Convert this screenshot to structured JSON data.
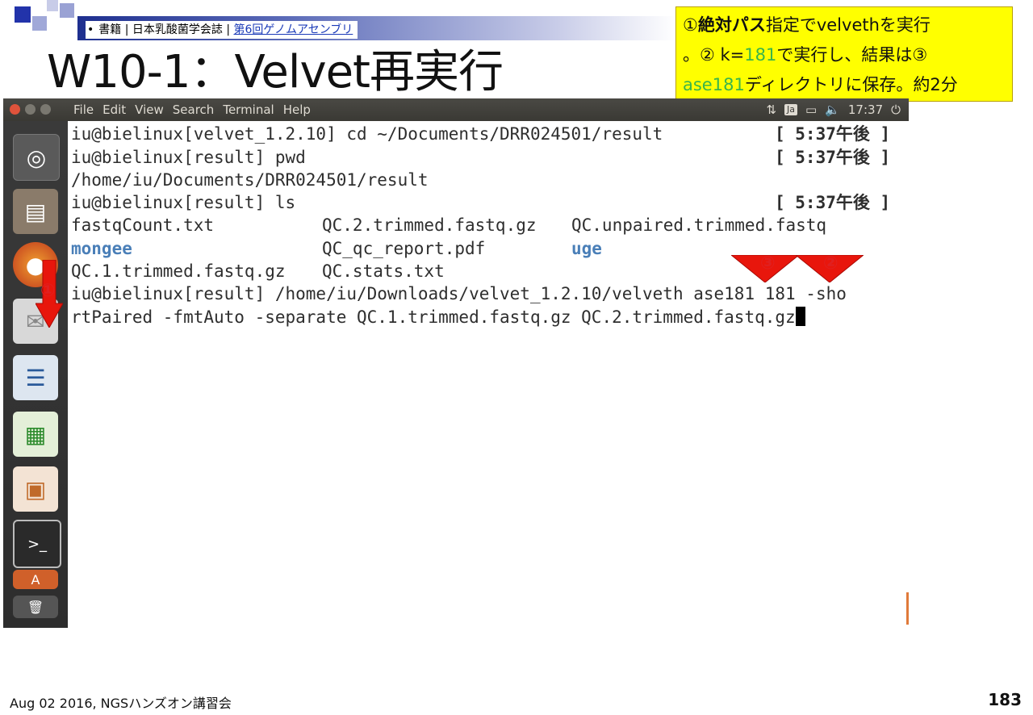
{
  "header": {
    "refs_bullet": "•",
    "refs_text": "書籍 | 日本乳酸菌学会誌 | ",
    "refs_link": "第6回ゲノムアセンブリ",
    "slide_title": "W10-1：Velvet再実行"
  },
  "callout": {
    "part1_num": "①",
    "part1_bold": "絶対パス",
    "part1_rest": "指定でvelvethを実行",
    "part2_start": "。② k=",
    "part2_green": "181",
    "part2_rest": "で実行し、結果は③",
    "part3_green": "ase181",
    "part3_rest": "ディレクトリに保存。約2分"
  },
  "window": {
    "menu": [
      "File",
      "Edit",
      "View",
      "Search",
      "Terminal",
      "Help"
    ],
    "tray": {
      "ime": "Ja",
      "time": "17:37"
    }
  },
  "launcher": {
    "items": [
      "ubuntu-dash",
      "files",
      "firefox",
      "mail",
      "writer",
      "calc",
      "impress",
      "terminal",
      "software",
      "trash"
    ]
  },
  "terminal": {
    "lines": [
      {
        "text": "iu@bielinux[velvet_1.2.10] cd ~/Documents/DRR024501/result",
        "time": "[ 5:37午後 ]"
      },
      {
        "text": "iu@bielinux[result] pwd",
        "time": "[ 5:37午後 ]"
      },
      {
        "text": "/home/iu/Documents/DRR024501/result",
        "time": ""
      },
      {
        "text": "iu@bielinux[result] ls",
        "time": "[ 5:37午後 ]"
      }
    ],
    "ls_row1": {
      "c1": "fastqCount.txt",
      "c2": "QC.2.trimmed.fastq.gz",
      "c3": "QC.unpaired.trimmed.fastq"
    },
    "ls_row2": {
      "c1": "mongee",
      "c2": "QC_qc_report.pdf",
      "c3": "uge"
    },
    "ls_row3": {
      "c1": "QC.1.trimmed.fastq.gz",
      "c2": "QC.stats.txt"
    },
    "cmd_line1": "iu@bielinux[result] /home/iu/Downloads/velvet_1.2.10/velveth ase181 181 -sho",
    "cmd_line2": "rtPaired -fmtAuto -separate QC.1.trimmed.fastq.gz QC.2.trimmed.fastq.gz"
  },
  "annotations": {
    "n1": "①",
    "n2": "②",
    "n3": "③",
    "arrow_color": "#e8160c"
  },
  "footer": {
    "left": "Aug 02 2016, NGSハンズオン講習会",
    "page": "183"
  }
}
